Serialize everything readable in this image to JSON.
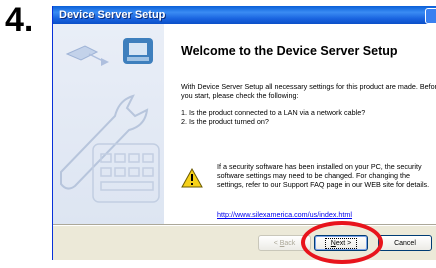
{
  "step": {
    "number": "4."
  },
  "window": {
    "title": "Device Server Setup"
  },
  "content": {
    "heading": "Welcome to the Device Server Setup",
    "intro": "With Device Server Setup all necessary settings for this product are made. Before you start, please check the following:",
    "checklist": [
      "1. Is the product connected to a LAN via a network cable?",
      "2. Is the product turned on?"
    ],
    "warning": "If a security software has been installed on your PC, the security software settings may need to be changed. For changing the settings, refer to our Support FAQ page in our WEB site for details.",
    "link": "http://www.silexamerica.com/us/index.html"
  },
  "buttons": {
    "back_prefix": "< ",
    "back_key": "B",
    "back_rest": "ack",
    "next_key": "N",
    "next_rest": "ext >",
    "cancel": "Cancel"
  },
  "annotation": {
    "color": "#e8141c"
  },
  "icons": [
    "computer-network-icon",
    "wrench-icon",
    "keyboard-icon",
    "warning-icon"
  ]
}
